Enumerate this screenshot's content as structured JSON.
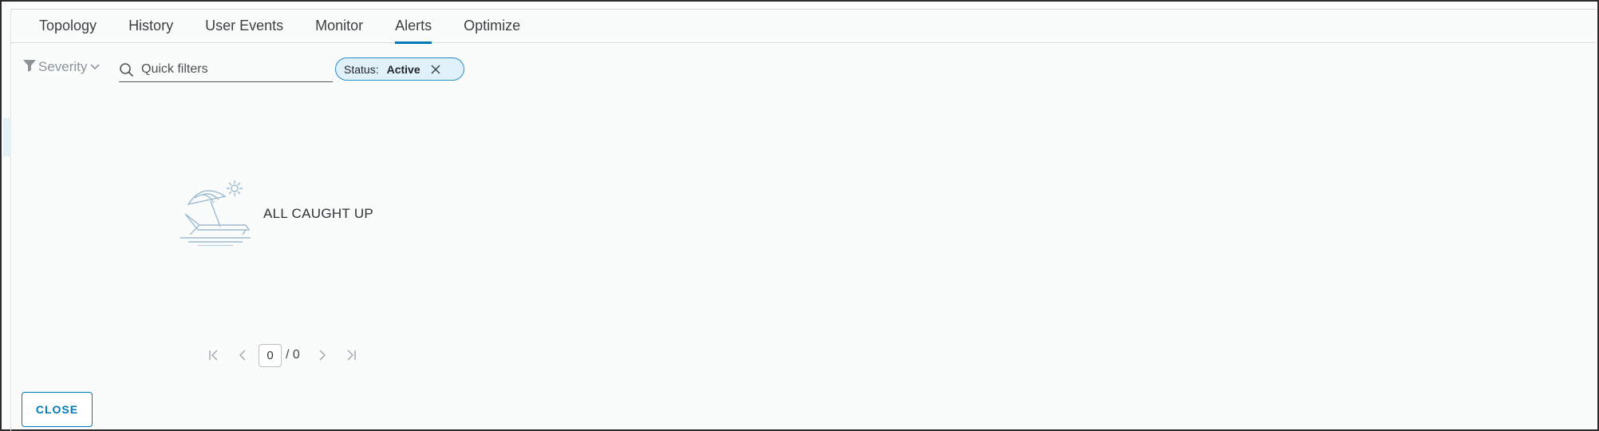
{
  "tabs": [
    {
      "label": "Topology"
    },
    {
      "label": "History"
    },
    {
      "label": "User Events"
    },
    {
      "label": "Monitor"
    },
    {
      "label": "Alerts",
      "active": true
    },
    {
      "label": "Optimize"
    }
  ],
  "filter": {
    "severity_label": "Severity",
    "search_placeholder": "Quick filters",
    "search_value": ""
  },
  "chip": {
    "key": "Status:",
    "value": "Active"
  },
  "empty_state": {
    "label": "ALL CAUGHT UP",
    "icon": "beach-chair-umbrella-icon"
  },
  "pagination": {
    "current": "0",
    "total": "/ 0"
  },
  "footer": {
    "close_label": "CLOSE"
  },
  "colors": {
    "accent": "#0079b8",
    "chip_bg": "#e1f1fa",
    "chip_border": "#2a8dc5",
    "muted": "#8c9499"
  }
}
